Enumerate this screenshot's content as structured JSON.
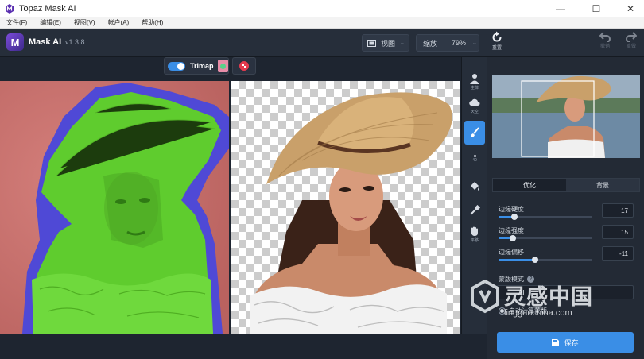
{
  "window": {
    "title": "Topaz Mask AI",
    "minimize": "—",
    "maximize": "☐",
    "close": "✕"
  },
  "menu": [
    "文件(F)",
    "编辑(E)",
    "视图(V)",
    "帐户(A)",
    "帮助(H)"
  ],
  "header": {
    "logo_letter": "M",
    "app_name": "Mask AI",
    "version": "v1.3.8",
    "view_label": "视图",
    "zoom_label": "缩放",
    "zoom_value": "79%",
    "reset_label": "重置",
    "undo_label": "撤销",
    "redo_label": "重做"
  },
  "subbar": {
    "trimap_label": "Trimap",
    "trimap_on": true
  },
  "tools": {
    "subject": "主体",
    "sky": "天空",
    "brush_size": "40",
    "pan": "平移"
  },
  "panel": {
    "tabs": [
      "优化",
      "背景"
    ],
    "sliders": [
      {
        "label": "边缘硬度",
        "value": "17",
        "level": 0.17
      },
      {
        "label": "边缘强度",
        "value": "15",
        "level": 0.15
      },
      {
        "label": "边缘偏移",
        "value": "-11",
        "level": 0.39
      }
    ],
    "mask_mode_label": "蒙版模式",
    "mask_mode_value": "AI",
    "auto_label": "自动计算蒙版",
    "save_label": "保存"
  },
  "watermark": {
    "brand": "灵感中国",
    "url": "lingganchina.com"
  },
  "colors": {
    "accent": "#3a8ee6",
    "save_button": "#3a8ee6",
    "keep_mask": "#5fd12e",
    "edge_mask": "#4f49d6",
    "remove_mask": "#c5726f"
  }
}
